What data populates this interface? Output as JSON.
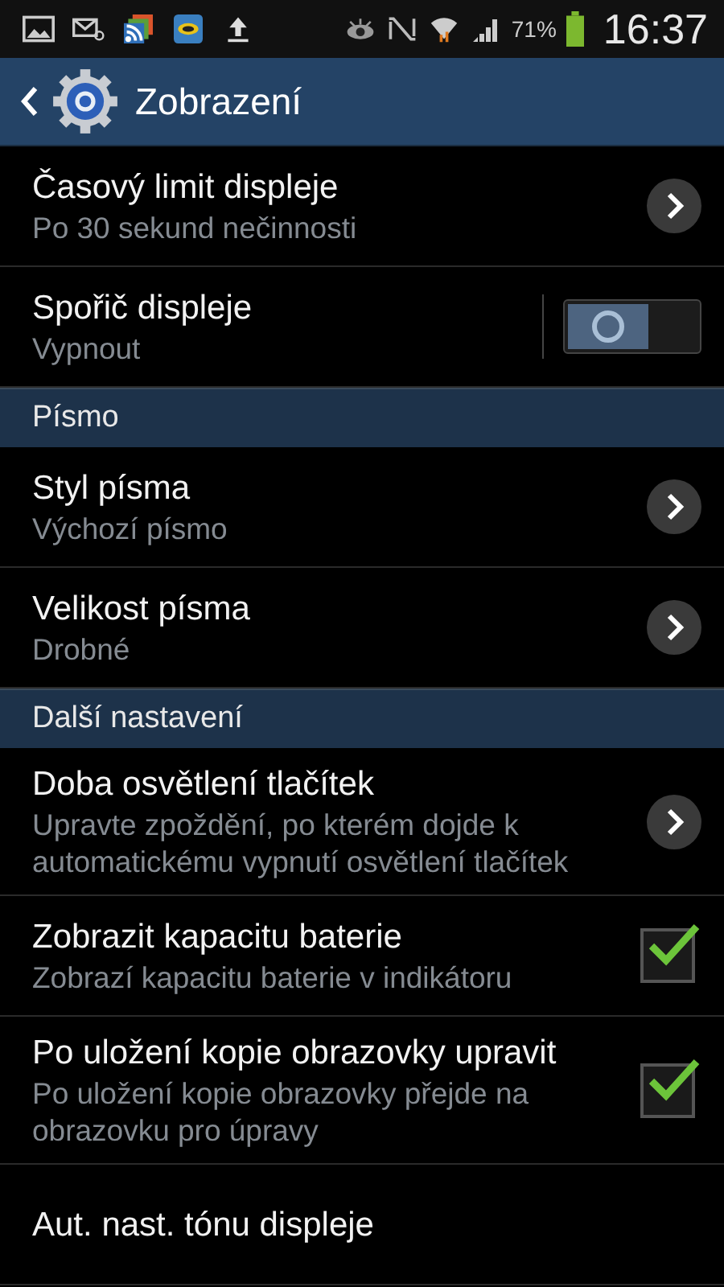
{
  "status_bar": {
    "battery": "71%",
    "time": "16:37"
  },
  "header": {
    "title": "Zobrazení"
  },
  "items": [
    {
      "kind": "nav",
      "title": "Časový limit displeje",
      "subtitle": "Po 30 sekund nečinnosti"
    },
    {
      "kind": "toggle",
      "title": "Spořič displeje",
      "subtitle": "Vypnout",
      "on": false
    },
    {
      "kind": "section",
      "title": "Písmo"
    },
    {
      "kind": "nav",
      "title": "Styl písma",
      "subtitle": "Výchozí písmo"
    },
    {
      "kind": "nav",
      "title": "Velikost písma",
      "subtitle": "Drobné"
    },
    {
      "kind": "section",
      "title": "Další nastavení"
    },
    {
      "kind": "nav",
      "title": "Doba osvětlení tlačítek",
      "subtitle": "Upravte zpoždění, po kterém dojde k automatickému vypnutí osvětlení tlačítek"
    },
    {
      "kind": "check",
      "title": "Zobrazit kapacitu baterie",
      "subtitle": "Zobrazí kapacitu baterie v indikátoru",
      "checked": true
    },
    {
      "kind": "check",
      "title": "Po uložení kopie obrazovky upravit",
      "subtitle": "Po uložení kopie obrazovky přejde na obrazovku pro úpravy",
      "checked": true
    },
    {
      "kind": "plain",
      "title": "Aut. nast. tónu displeje"
    }
  ]
}
